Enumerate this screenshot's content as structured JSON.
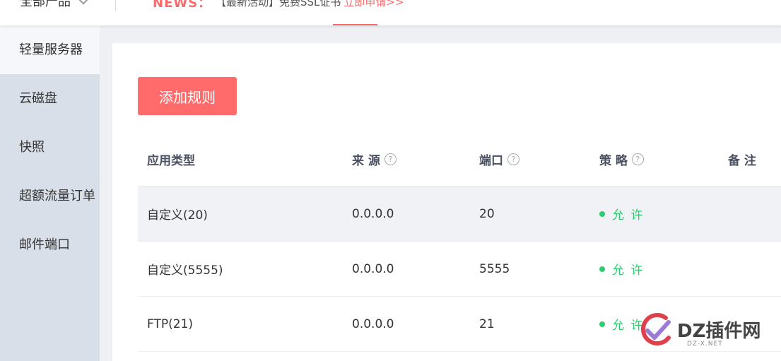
{
  "topbar": {
    "product_select": "全部产品",
    "news_label": "NEWS：",
    "news_text": "【最新活动】免费SSL证书",
    "news_link": "立即申请>>"
  },
  "sidebar": {
    "items": [
      {
        "label": "轻量服务器",
        "active": true
      },
      {
        "label": "云磁盘"
      },
      {
        "label": "快照"
      },
      {
        "label": "超额流量订单"
      },
      {
        "label": "邮件端口"
      }
    ]
  },
  "main": {
    "add_button": "添加规则",
    "columns": [
      "应用类型",
      "来 源",
      "端口",
      "策 略",
      "备 注"
    ],
    "rows": [
      {
        "type": "自定义(20)",
        "source": "0.0.0.0",
        "port": "20",
        "policy": "允 许"
      },
      {
        "type": "自定义(5555)",
        "source": "0.0.0.0",
        "port": "5555",
        "policy": "允 许"
      },
      {
        "type": "FTP(21)",
        "source": "0.0.0.0",
        "port": "21",
        "policy": "允 许"
      }
    ]
  },
  "watermark": {
    "text": "DZ插件网",
    "sub": "DZ-X.NET"
  },
  "colors": {
    "accent": "#ff6b6b",
    "allow": "#2ecc71",
    "sidebar": "#d9dfe8"
  }
}
